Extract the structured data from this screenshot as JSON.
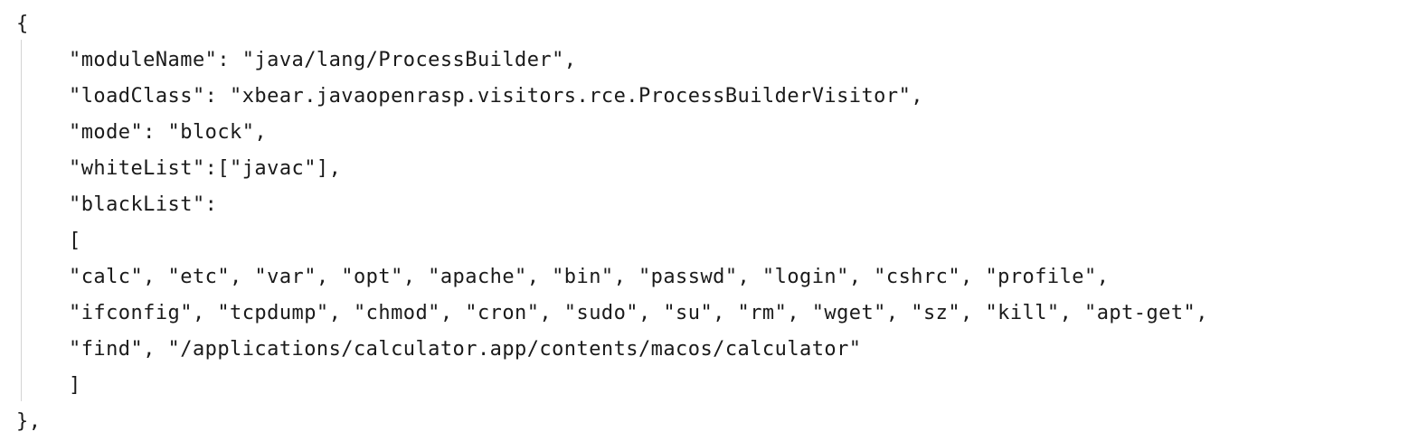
{
  "document": {
    "lines": [
      "{",
      "\"moduleName\": \"java/lang/ProcessBuilder\",",
      "\"loadClass\": \"xbear.javaopenrasp.visitors.rce.ProcessBuilderVisitor\",",
      "\"mode\": \"block\",",
      "\"whiteList\":[\"javac\"],",
      "\"blackList\":",
      "[",
      "\"calc\", \"etc\", \"var\", \"opt\", \"apache\", \"bin\", \"passwd\", \"login\", \"cshrc\", \"profile\",",
      "\"ifconfig\", \"tcpdump\", \"chmod\", \"cron\", \"sudo\", \"su\", \"rm\", \"wget\", \"sz\", \"kill\", \"apt-get\",",
      "\"find\", \"/applications/calculator.app/contents/macos/calculator\"",
      "]",
      "},"
    ]
  }
}
